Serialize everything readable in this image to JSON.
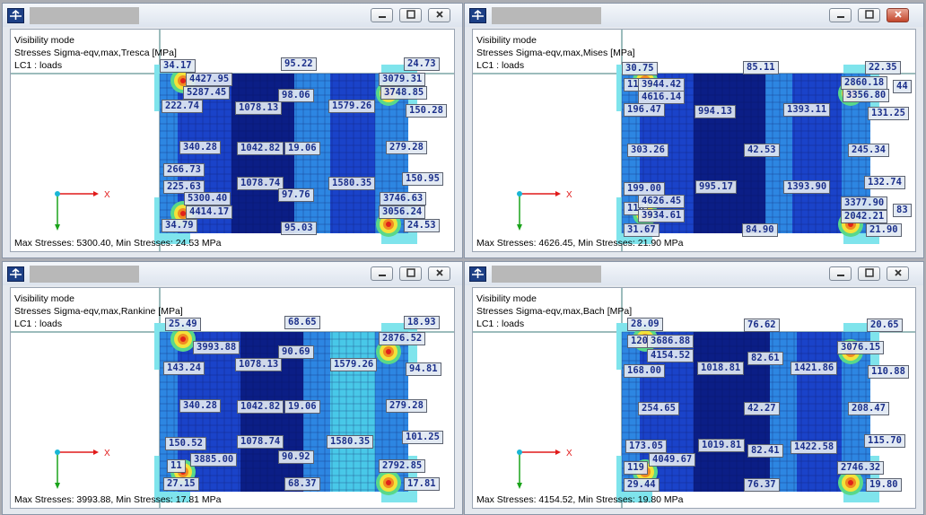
{
  "colors": {
    "mesh_dark": "#0b1e86",
    "mesh_mid": "#1a43c9",
    "mesh_light": "#2d86e2",
    "mesh_cyan": "#48c8e8",
    "mesh_pale": "#7fe4ec",
    "axis_x": "#e11a1a",
    "axis_y": "#1aa31a",
    "origin": "#19b6d6"
  },
  "icons": [
    "app-logo-icon",
    "minimize-icon",
    "maximize-icon",
    "close-icon"
  ],
  "windows": [
    {
      "id": "tresca",
      "info": [
        "Visibility mode",
        "Stresses Sigma-eqv,max,Tresca [MPa]",
        "LC1 : loads"
      ],
      "status": "Max Stresses: 5300.40, Min Stresses: 24.53 MPa",
      "axis_x_label": "X",
      "close_active": false,
      "labels": [
        "34.17",
        "4427.95",
        "5287.45",
        "222.74",
        "1078.13",
        "95.22",
        "98.06",
        "1579.26",
        "3079.31",
        "3748.85",
        "24.73",
        "150.28",
        "340.28",
        "1042.82",
        "19.06",
        "279.28",
        "266.73",
        "225.63",
        "1078.74",
        "97.76",
        "1580.35",
        "150.95",
        "5300.40",
        "4414.17",
        "3746.63",
        "3056.24",
        "34.79",
        "95.03",
        "24.53"
      ]
    },
    {
      "id": "mises",
      "info": [
        "Visibility mode",
        "Stresses Sigma-eqv,max,Mises [MPa]",
        "LC1 : loads"
      ],
      "status": "Max Stresses: 4626.45, Min Stresses: 21.90 MPa",
      "axis_x_label": "X",
      "close_active": true,
      "labels": [
        "30.75",
        "117",
        "3944.42",
        "4616.14",
        "196.47",
        "994.13",
        "85.11",
        "1393.11",
        "2860.18",
        "3356.80",
        "22.35",
        "44",
        "131.25",
        "303.26",
        "42.53",
        "245.34",
        "199.00",
        "995.17",
        "1393.90",
        "132.74",
        "116",
        "4626.45",
        "3934.61",
        "3377.90",
        "2042.21",
        "31.67",
        "84.90",
        "21.90",
        "83"
      ]
    },
    {
      "id": "rankine",
      "info": [
        "Visibility mode",
        "Stresses Sigma-eqv,max,Rankine [MPa]",
        "LC1 : loads"
      ],
      "status": "Max Stresses: 3993.88, Min Stresses: 17.81 MPa",
      "axis_x_label": "X",
      "close_active": false,
      "labels": [
        "25.49",
        "3993.88",
        "143.24",
        "1078.13",
        "68.65",
        "90.69",
        "1579.26",
        "2876.52",
        "18.93",
        "94.81",
        "340.28",
        "1042.82",
        "19.06",
        "279.28",
        "150.52",
        "1078.74",
        "90.92",
        "1580.35",
        "101.25",
        "3885.00",
        "2792.85",
        "27.15",
        "68.37",
        "17.81",
        "11"
      ]
    },
    {
      "id": "bach",
      "info": [
        "Visibility mode",
        "Stresses Sigma-eqv,max,Bach [MPa]",
        "LC1 : loads"
      ],
      "status": "Max Stresses: 4154.52, Min Stresses: 19.80 MPa",
      "axis_x_label": "X",
      "close_active": false,
      "labels": [
        "28.09",
        "120",
        "3686.88",
        "4154.52",
        "168.00",
        "1018.81",
        "76.62",
        "82.61",
        "1421.86",
        "3076.15",
        "20.65",
        "110.88",
        "254.65",
        "42.27",
        "208.47",
        "173.05",
        "1019.81",
        "82.41",
        "1422.58",
        "115.70",
        "119",
        "4049.67",
        "2746.32",
        "29.44",
        "76.37",
        "19.80"
      ]
    }
  ]
}
